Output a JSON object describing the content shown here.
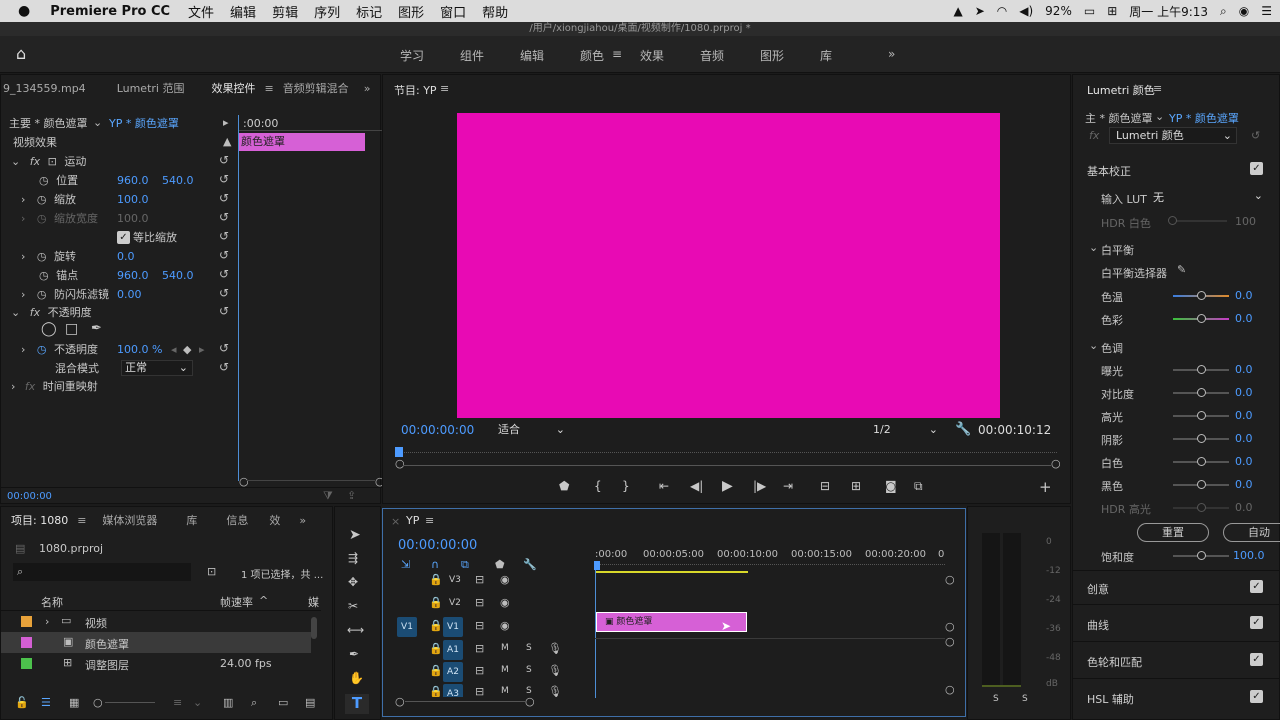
{
  "mac": {
    "apple": "",
    "app": "Premiere Pro CC",
    "menus": [
      "文件",
      "编辑",
      "剪辑",
      "序列",
      "标记",
      "图形",
      "窗口",
      "帮助"
    ],
    "battery": "92%",
    "clock": "周一 上午9:13"
  },
  "titlebar": "/用户/xiongjiahou/桌面/视频制作/1080.prproj *",
  "workspaces": [
    "学习",
    "组件",
    "编辑",
    "颜色",
    "效果",
    "音频",
    "图形",
    "库"
  ],
  "effect_panel": {
    "tabs": [
      "9_134559.mp4",
      "Lumetri 范围",
      "效果控件",
      "音频剪辑混合"
    ],
    "source": "主要 * 颜色遮罩",
    "seq": "YP * 颜色遮罩",
    "time": ":00:00",
    "clip": "颜色遮罩",
    "video_effects": "视频效果",
    "motion": "运动",
    "position": {
      "label": "位置",
      "x": "960.0",
      "y": "540.0"
    },
    "scale": {
      "label": "缩放",
      "v": "100.0"
    },
    "scale_width": {
      "label": "缩放宽度",
      "v": "100.0"
    },
    "uniform": "等比缩放",
    "rotation": {
      "label": "旋转",
      "v": "0.0"
    },
    "anchor": {
      "label": "锚点",
      "x": "960.0",
      "y": "540.0"
    },
    "flicker": {
      "label": "防闪烁滤镜",
      "v": "0.00"
    },
    "opacity_title": "不透明度",
    "opacity": {
      "label": "不透明度",
      "v": "100.0 %"
    },
    "blend": {
      "label": "混合模式",
      "v": "正常"
    },
    "time_remap": "时间重映射",
    "bottom_time": "00:00:00"
  },
  "program": {
    "title": "节目: YP",
    "timecode": "00:00:00:00",
    "fit": "适合",
    "res": "1/2",
    "duration": "00:00:10:12",
    "frame_color": "#E80AB4"
  },
  "lumetri": {
    "title": "Lumetri 颜色",
    "source": "主 * 颜色遮罩",
    "seq": "YP * 颜色遮罩",
    "fx": "Lumetri 颜色",
    "basic": "基本校正",
    "lut_label": "输入 LUT",
    "lut_value": "无",
    "hdr_white": "HDR 白色",
    "hdr_val": "100",
    "wb": "白平衡",
    "wb_picker": "白平衡选择器",
    "temp": "色温",
    "tint": "色彩",
    "zero": "0.0",
    "tone": "色调",
    "exposure": "曝光",
    "contrast": "对比度",
    "highlights": "高光",
    "shadows": "阴影",
    "whites": "白色",
    "blacks": "黑色",
    "hdr_spec": "HDR 高光",
    "reset": "重置",
    "auto": "自动",
    "saturation": "饱和度",
    "sat_val": "100.0",
    "sections": [
      "创意",
      "曲线",
      "色轮和匹配",
      "HSL 辅助"
    ]
  },
  "project": {
    "tabs": [
      "项目: 1080",
      "媒体浏览器",
      "库",
      "信息",
      "效"
    ],
    "file": "1080.prproj",
    "sel": "1 项已选择，共 ...",
    "col_name": "名称",
    "col_rate": "帧速率",
    "col_media": "媒",
    "items": [
      {
        "name": "视频",
        "rate": "",
        "color": "#E8A23A"
      },
      {
        "name": "颜色遮罩",
        "rate": "",
        "color": "#D45FD4"
      },
      {
        "name": "调整图层",
        "rate": "24.00 fps",
        "color": "#4CC24C"
      }
    ]
  },
  "timeline": {
    "title": "YP",
    "timecode": "00:00:00:00",
    "ruler": [
      ":00:00",
      "00:00:05:00",
      "00:00:10:00",
      "00:00:15:00",
      "00:00:20:00",
      "0"
    ],
    "tracks": [
      "V3",
      "V2",
      "V1",
      "A1",
      "A2",
      "A3"
    ],
    "clip": "颜色遮罩",
    "m": "M",
    "s": "S"
  },
  "meter": {
    "labels": [
      "0",
      "-12",
      "-24",
      "-36",
      "-48",
      "dB"
    ],
    "s": "S"
  }
}
